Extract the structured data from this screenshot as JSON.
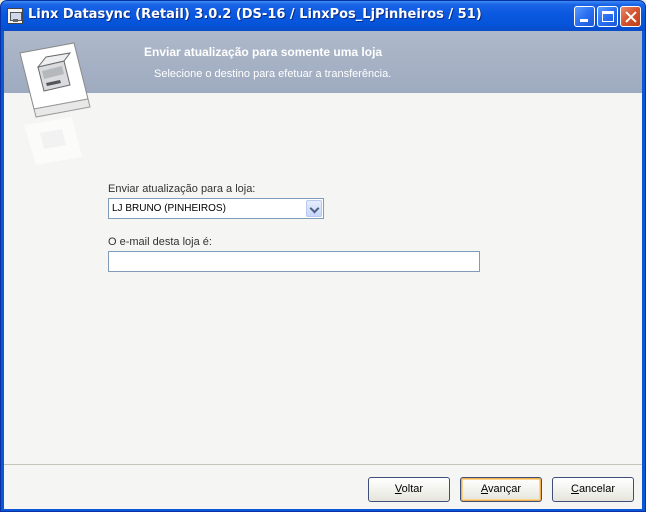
{
  "window": {
    "title": "Linx Datasync (Retail) 3.0.2 (DS-16 / LinxPos_LjPinheiros / 51)"
  },
  "banner": {
    "title": "Enviar atualização para somente uma loja",
    "subtitle": "Selecione o destino para efetuar a transferência."
  },
  "form": {
    "store_label": "Enviar atualização para a loja:",
    "store_value": "LJ BRUNO (PINHEIROS)",
    "email_label": "O e-mail desta loja é:",
    "email_value": ""
  },
  "buttons": {
    "back": {
      "hotkey": "V",
      "rest": "oltar"
    },
    "next": {
      "hotkey": "A",
      "rest": "vançar"
    },
    "cancel": {
      "hotkey": "C",
      "rest": "ancelar"
    }
  },
  "icons": {
    "app": "printer-app-icon",
    "banner": "receipt-printer-icon",
    "dropdown": "chevron-down-icon"
  }
}
